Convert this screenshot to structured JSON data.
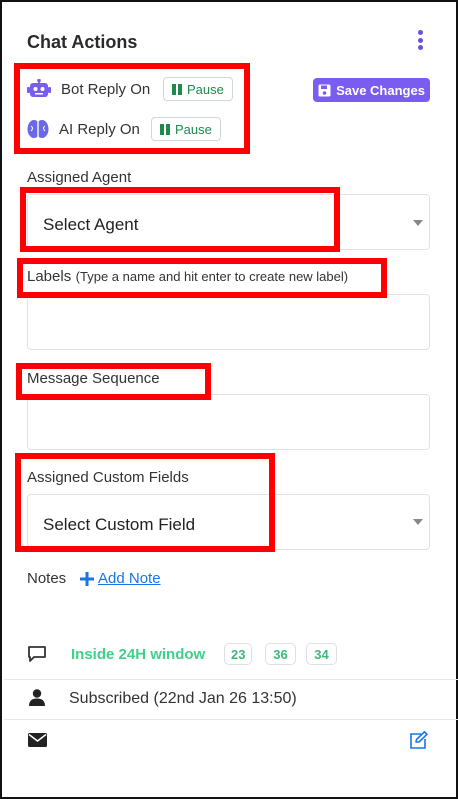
{
  "panel": {
    "title": "Chat Actions",
    "menu_icon": "vertical-dots-icon"
  },
  "bot_reply": {
    "label": "Bot Reply On",
    "icon": "robot-icon",
    "pause_label": "Pause"
  },
  "ai_reply": {
    "label": "AI Reply On",
    "icon": "brain-icon",
    "pause_label": "Pause"
  },
  "save_button": {
    "label": "Save Changes",
    "icon": "floppy-disk-icon"
  },
  "assigned_agent": {
    "label": "Assigned Agent",
    "value": "Select Agent"
  },
  "labels_field": {
    "label": "Labels",
    "hint": "(Type a name and hit enter to create new label)",
    "value": ""
  },
  "message_sequence": {
    "label": "Message Sequence",
    "value": ""
  },
  "custom_fields": {
    "label": "Assigned Custom Fields",
    "value": "Select Custom Field"
  },
  "notes": {
    "label": "Notes",
    "add_label": "Add Note"
  },
  "status": {
    "window_text": "Inside 24H window",
    "counters": [
      "23",
      "36",
      "34"
    ]
  },
  "subscription": {
    "text": "Subscribed (22nd Jan 26 13:50)"
  },
  "colors": {
    "accent": "#7a5cf0",
    "pause_green": "#1e8a4c",
    "window_green": "#3fd08a",
    "link_blue": "#1a73e8",
    "highlight_red": "#ff0000"
  }
}
